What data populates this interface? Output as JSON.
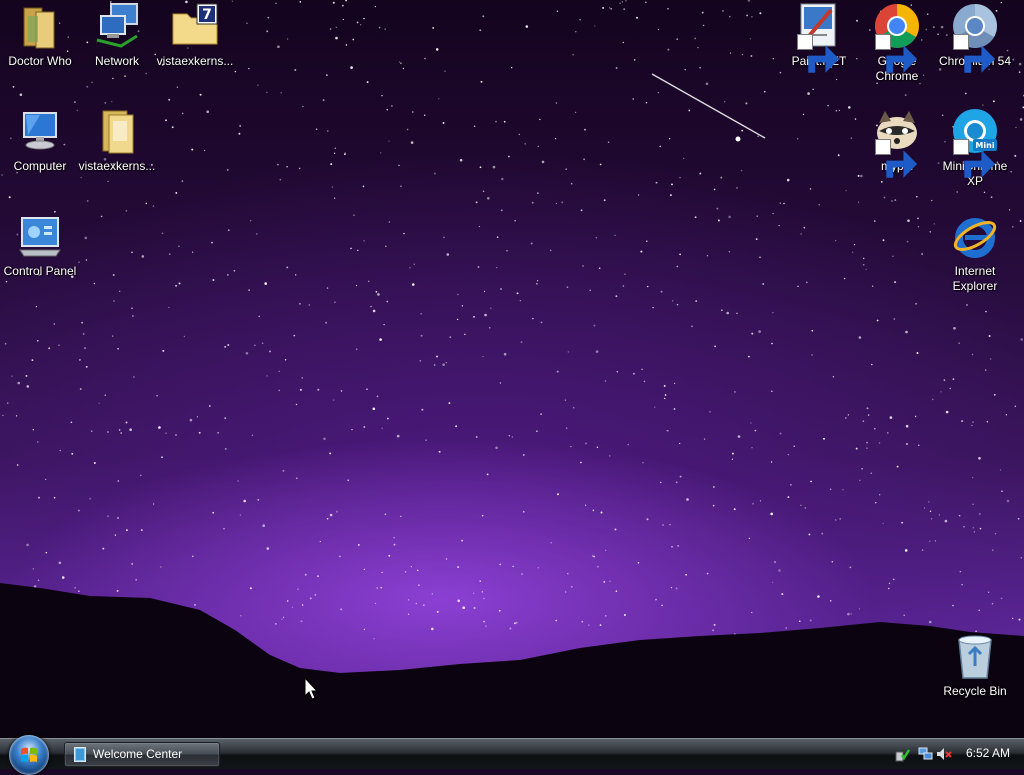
{
  "desktop": {
    "left_icons": [
      {
        "label": "Doctor Who",
        "icon": "folder-icon"
      },
      {
        "label": "Network",
        "icon": "network-icon"
      },
      {
        "label": "vistaexkerns...",
        "icon": "archive-folder-icon"
      },
      {
        "label": "Computer",
        "icon": "computer-icon"
      },
      {
        "label": "vistaexkerns...",
        "icon": "folder-icon"
      },
      {
        "label": "Control Panel",
        "icon": "control-panel-icon"
      }
    ],
    "right_icons": [
      {
        "label": "Paint.NET",
        "icon": "paint-net-icon"
      },
      {
        "label": "Google\nChrome",
        "line1": "Google",
        "line2": "Chrome",
        "icon": "chrome-icon"
      },
      {
        "label": "Chromium 54",
        "icon": "chromium-icon"
      },
      {
        "label": "mypal",
        "icon": "mypal-icon"
      },
      {
        "label": "MiniChrome XP",
        "line1": "MiniChrome",
        "line2": "XP",
        "icon": "minichrome-icon"
      },
      {
        "label": "Internet Explorer",
        "line1": "Internet",
        "line2": "Explorer",
        "icon": "internet-explorer-icon"
      },
      {
        "label": "Recycle Bin",
        "icon": "recycle-bin-icon"
      }
    ]
  },
  "taskbar": {
    "start_button": "start-orb-icon",
    "window_button": {
      "label": "Welcome Center",
      "icon": "welcome-center-icon"
    },
    "tray_icons": [
      "safely-remove-icon",
      "network-status-icon",
      "volume-muted-icon"
    ],
    "clock": "6:52 AM"
  },
  "colors": {
    "sky_top": "#14041e",
    "sky_glow": "#9646e1",
    "mountains": "#0b030f",
    "taskbar": "#121518"
  }
}
